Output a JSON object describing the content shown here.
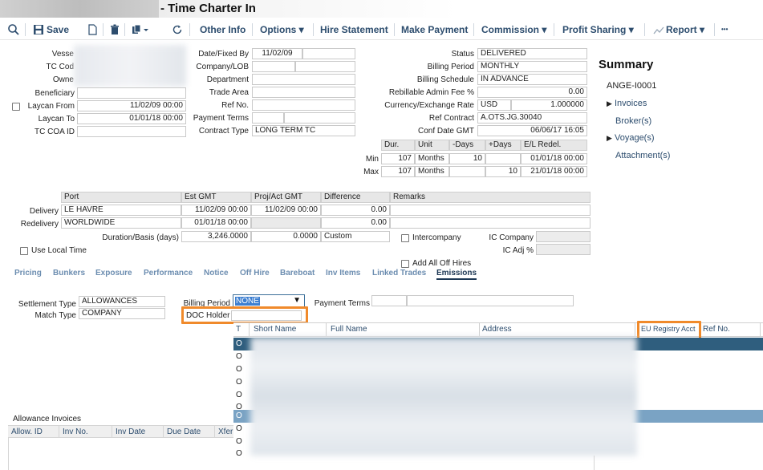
{
  "window": {
    "title": "- Time Charter In"
  },
  "toolbar": {
    "save": "Save",
    "other_info": "Other Info",
    "options": "Options",
    "hire_statement": "Hire Statement",
    "make_payment": "Make Payment",
    "commission": "Commission",
    "profit_sharing": "Profit Sharing",
    "report": "Report",
    "more": "•••"
  },
  "left_form": {
    "vessel_label": "Vesse",
    "tc_code_label": "TC Cod",
    "owner_label": "Owne",
    "beneficiary_label": "Beneficiary",
    "laycan_from_label": "Laycan From",
    "laycan_from_value": "11/02/09 00:00",
    "laycan_to_label": "Laycan To",
    "laycan_to_value": "01/01/18 00:00",
    "tc_coa_id_label": "TC COA ID"
  },
  "mid_form": {
    "date_fixed_by_label": "Date/Fixed By",
    "date_fixed_by_value": "11/02/09",
    "company_lob_label": "Company/LOB",
    "department_label": "Department",
    "trade_area_label": "Trade Area",
    "ref_no_label": "Ref No.",
    "payment_terms_label": "Payment Terms",
    "contract_type_label": "Contract Type",
    "contract_type_value": "LONG TERM TC"
  },
  "right_form": {
    "status_label": "Status",
    "status_value": "DELIVERED",
    "billing_period_label": "Billing Period",
    "billing_period_value": "MONTHLY",
    "billing_schedule_label": "Billing Schedule",
    "billing_schedule_value": "IN ADVANCE",
    "rebillable_label": "Rebillable Admin Fee %",
    "rebillable_value": "0.00",
    "currency_label": "Currency/Exchange Rate",
    "currency_value": "USD",
    "exchange_rate_value": "1.000000",
    "ref_contract_label": "Ref Contract",
    "ref_contract_value": "A.OTS.JG.30040",
    "conf_date_label": "Conf Date GMT",
    "conf_date_value": "06/06/17 16:05"
  },
  "duration_table": {
    "headers": [
      "Dur.",
      "Unit",
      "-Days",
      "+Days",
      "E/L Redel."
    ],
    "rows": [
      {
        "label": "Min",
        "dur": "107",
        "unit": "Months",
        "minus": "10",
        "plus": "",
        "redel": "01/01/18 00:00"
      },
      {
        "label": "Max",
        "dur": "107",
        "unit": "Months",
        "minus": "",
        "plus": "10",
        "redel": "21/01/18 00:00"
      }
    ]
  },
  "summary": {
    "title": "Summary",
    "code": "ANGE-I0001",
    "invoices": "Invoices",
    "brokers": "Broker(s)",
    "voyages": "Voyage(s)",
    "attachments": "Attachment(s)"
  },
  "port_table": {
    "headers": [
      "Port",
      "Est GMT",
      "Proj/Act GMT",
      "Difference",
      "Remarks"
    ],
    "rows": [
      {
        "label": "Delivery",
        "port": "LE HAVRE",
        "est": "11/02/09 00:00",
        "proj": "11/02/09 00:00",
        "diff": "0.00"
      },
      {
        "label": "Redelivery",
        "port": "WORLDWIDE",
        "est": "01/01/18 00:00",
        "proj": "",
        "diff": "0.00"
      }
    ],
    "duration_label": "Duration/Basis (days)",
    "duration_value": "3,246.0000",
    "duration_diff": "0.0000",
    "duration_basis": "Custom"
  },
  "options": {
    "intercompany": "Intercompany",
    "ic_company": "IC Company",
    "ic_adj": "IC Adj %",
    "use_local_time": "Use Local Time",
    "add_all_off_hires": "Add All Off Hires"
  },
  "tabs": [
    "Pricing",
    "Bunkers",
    "Exposure",
    "Performance",
    "Notice",
    "Off Hire",
    "Bareboat",
    "Inv Items",
    "Linked Trades",
    "Emissions"
  ],
  "emissions": {
    "settlement_type_label": "Settlement Type",
    "settlement_type_value": "ALLOWANCES",
    "match_type_label": "Match Type",
    "match_type_value": "COMPANY",
    "billing_period_label": "Billing Period",
    "billing_period_value": "NONE",
    "payment_terms_label": "Payment Terms",
    "doc_holder_label": "DOC Holder"
  },
  "popup": {
    "headers": [
      "T",
      "Short Name",
      "Full Name",
      "Address",
      "EU Registry Acct",
      "Ref No."
    ],
    "row_marker": "O"
  },
  "allowance": {
    "title": "Allowance Invoices",
    "headers": [
      "Allow. ID",
      "Inv No.",
      "Inv Date",
      "Due Date",
      "Xfer"
    ]
  },
  "colors": {
    "accent": "#2d4d6e",
    "highlight": "#f08a2b",
    "selected_row": "#2f5e7e"
  }
}
